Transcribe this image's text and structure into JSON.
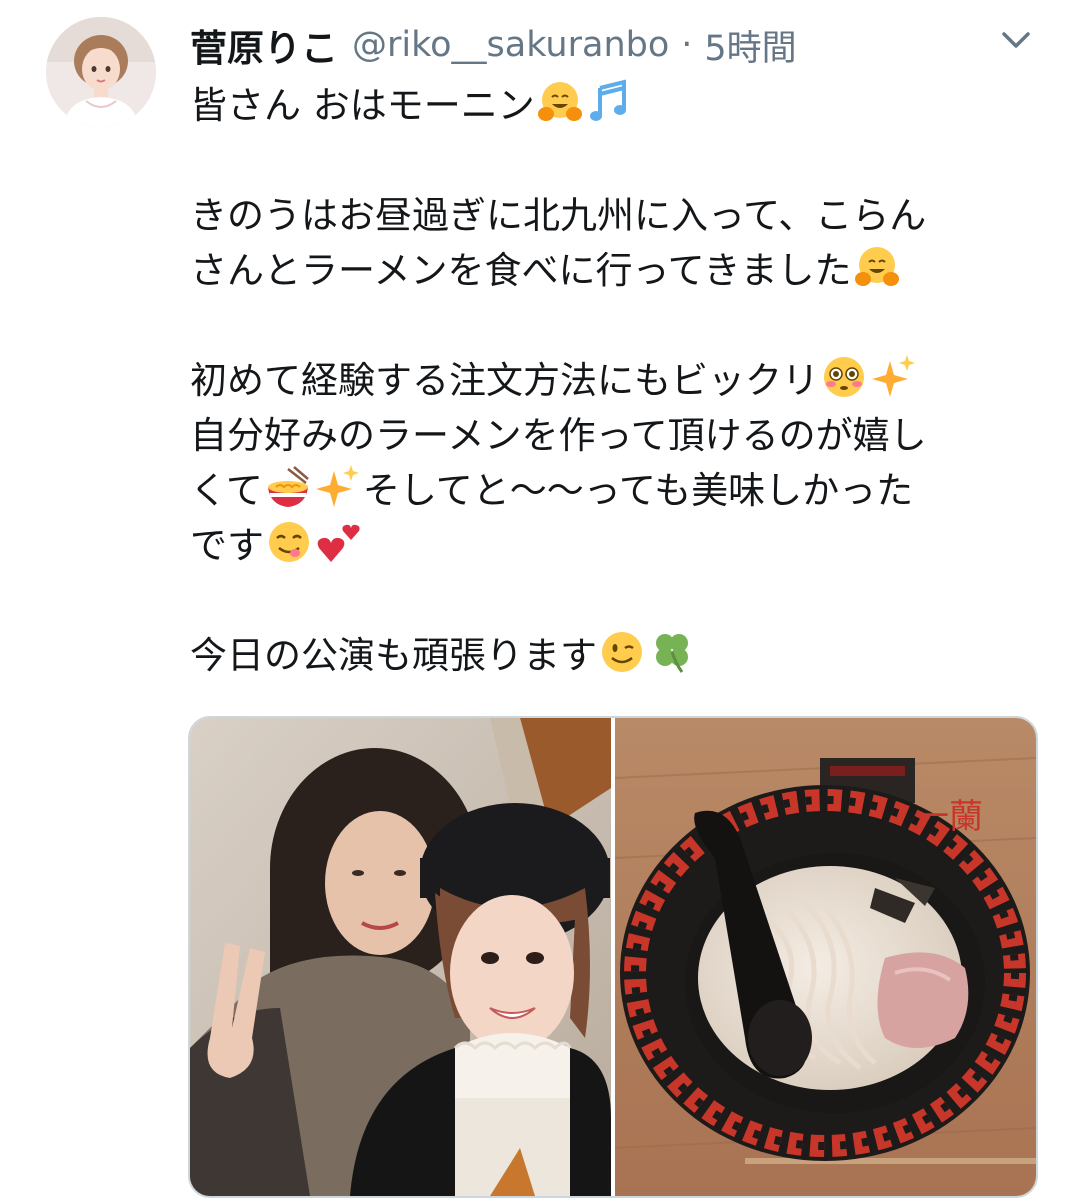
{
  "tweet": {
    "author": {
      "display_name": "菅原りこ",
      "handle": "@riko__sakuranbo"
    },
    "separator": "·",
    "timestamp": "5時間",
    "body": {
      "l1": "皆さん おはモーニン",
      "l2": "きのうはお昼過ぎに北九州に入って、こらん",
      "l3": "さんとラーメンを食べに行ってきました",
      "l4": "初めて経験する注文方法にもビックリ",
      "l5": "自分好みのラーメンを作って頂けるのが嬉し",
      "l6a": "くて",
      "l6b": "そしてと〜〜っても美味しかった",
      "l7": "です",
      "l8": "今日の公演も頑張ります"
    },
    "emoji": [
      "hugging-face-emoji",
      "musical-notes-emoji",
      "flushed-face-emoji",
      "sparkles-emoji",
      "ramen-bowl-emoji",
      "yum-face-emoji",
      "two-hearts-emoji",
      "winking-face-emoji",
      "four-leaf-clover-emoji"
    ],
    "media": [
      {
        "name": "selfie-photo",
        "subject": "two people selfie"
      },
      {
        "name": "ramen-photo",
        "subject": "bowl of tonkotsu ramen"
      }
    ]
  },
  "colors": {
    "text": "#14171a",
    "secondary": "#657786",
    "media_border": "#ccd6dd"
  }
}
